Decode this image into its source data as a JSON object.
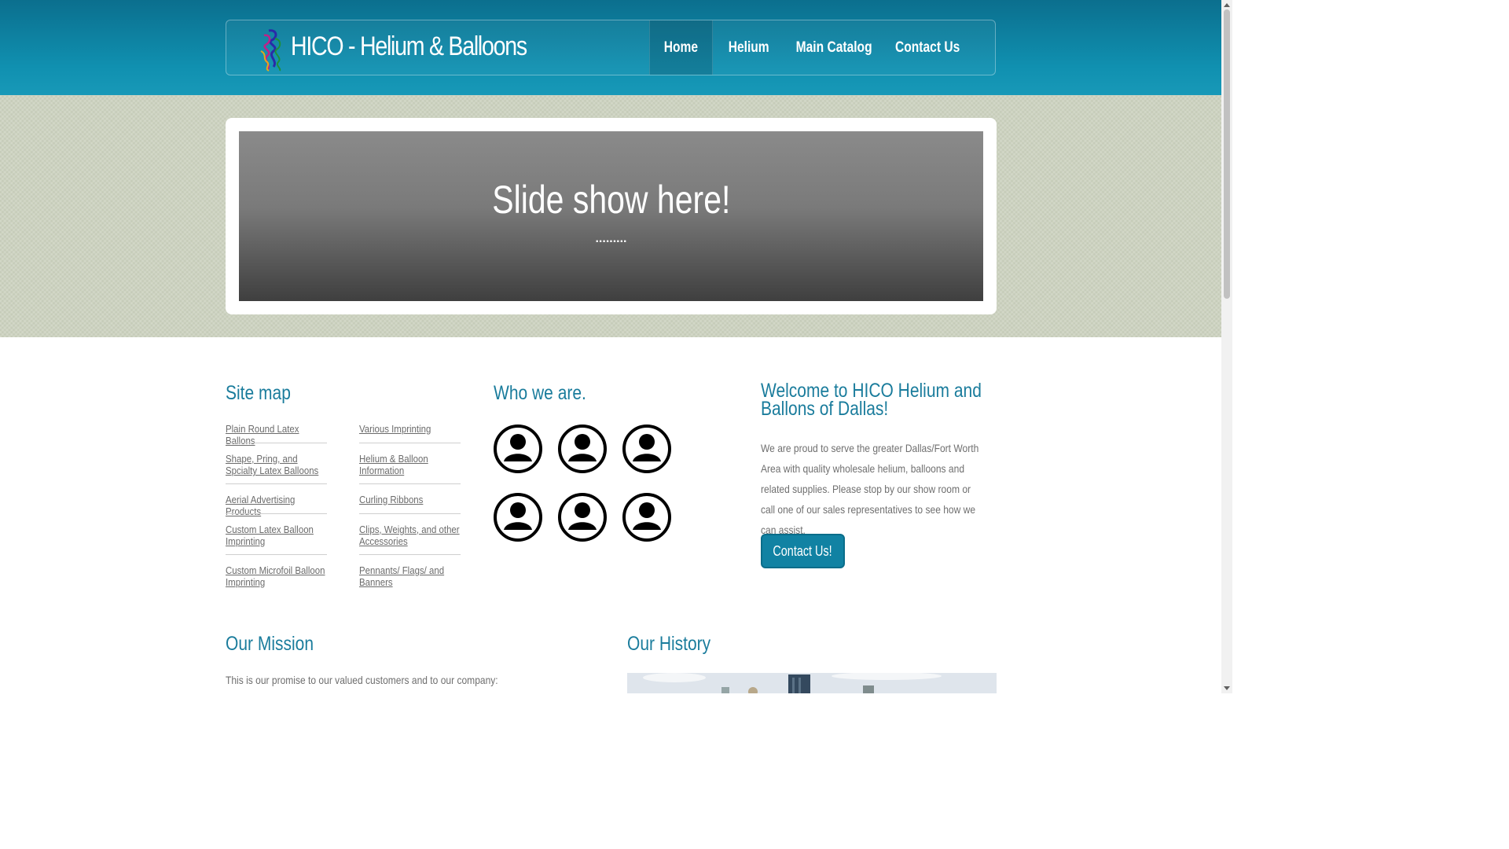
{
  "header": {
    "brand": "HICO - Helium & Balloons",
    "nav": [
      {
        "label": "Home",
        "active": true
      },
      {
        "label": "Helium",
        "active": false
      },
      {
        "label": "Main Catalog",
        "active": false
      },
      {
        "label": "Contact Us",
        "active": false
      }
    ]
  },
  "slideshow": {
    "title": "Slide show here!",
    "dots": "........."
  },
  "sitemap": {
    "title": "Site map",
    "left": [
      "Plain Round Latex Ballons",
      "Shape, Pring, and Spcialty Latex Balloons",
      "Aerial Advertising Products",
      "Custom Latex Balloon Imprinting",
      "Custom Microfoil Balloon Imprinting"
    ],
    "right": [
      "Various Imprinting",
      "Helium & Balloon Information",
      "Curling Ribbons",
      "Clips, Weights, and other Accessories",
      "Pennants/ Flags/ and Banners"
    ]
  },
  "who": {
    "title": "Who we are."
  },
  "welcome": {
    "title": "Welcome to HICO Helium and Ballons of Dallas!",
    "text": "We are proud to serve the greater Dallas/Fort Worth Area with quality wholesale helium, balloons and related supplies. Please stop by our show room or call one of our sales representatives to see how we can assist.",
    "button": "Contact Us!"
  },
  "mission": {
    "title": "Our Mission",
    "text": "This is our promise to our valued customers and to our company:"
  },
  "history": {
    "title": "Our History"
  },
  "colors": {
    "header": "#1090b0",
    "accent": "#1a7c9c",
    "button": "#1182a3",
    "banner": "#cdd3c0"
  }
}
